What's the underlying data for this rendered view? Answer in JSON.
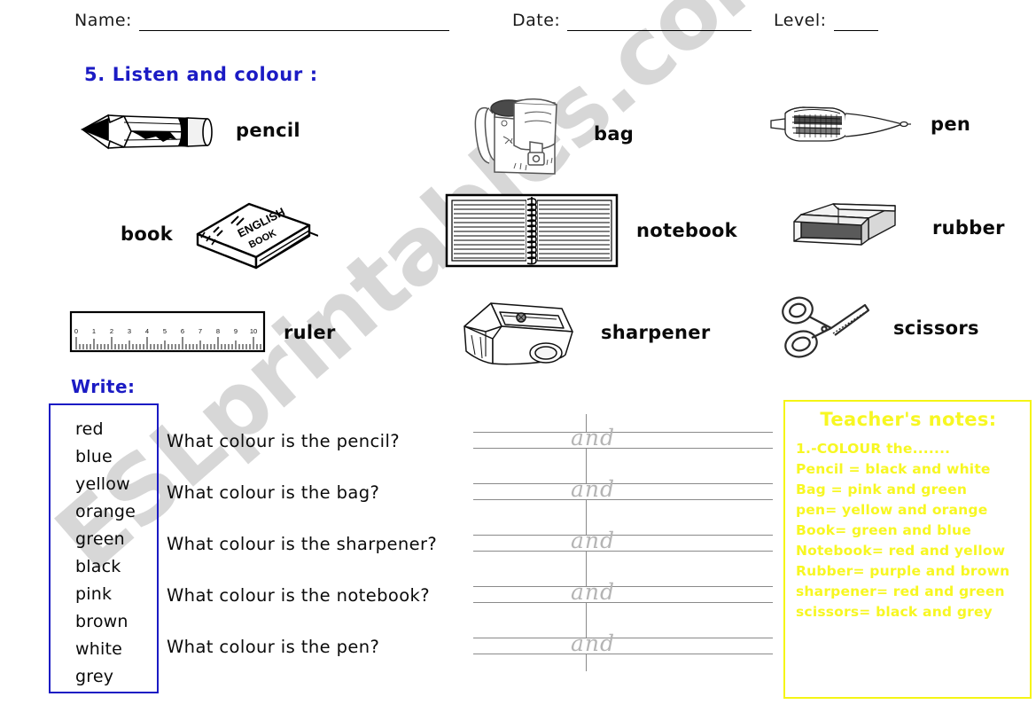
{
  "header": {
    "name_label": "Name:",
    "date_label": "Date:",
    "level_label": "Level:"
  },
  "section": {
    "title": "5. Listen and colour :"
  },
  "vocabulary": [
    {
      "key": "pencil",
      "label": "pencil",
      "icon": "pencil-icon"
    },
    {
      "key": "bag",
      "label": "bag",
      "icon": "bag-icon"
    },
    {
      "key": "pen",
      "label": "pen",
      "icon": "pen-icon"
    },
    {
      "key": "book",
      "label": "book",
      "icon": "book-icon",
      "book_text_line1": "ENGLISH",
      "book_text_line2": "BOOK"
    },
    {
      "key": "notebook",
      "label": "notebook",
      "icon": "notebook-icon"
    },
    {
      "key": "rubber",
      "label": "rubber",
      "icon": "rubber-icon"
    },
    {
      "key": "ruler",
      "label": "ruler",
      "icon": "ruler-icon",
      "ticks": [
        "0",
        "1",
        "2",
        "3",
        "4",
        "5",
        "6",
        "7",
        "8",
        "9",
        "10"
      ]
    },
    {
      "key": "sharpener",
      "label": "sharpener",
      "icon": "sharpener-icon"
    },
    {
      "key": "scissors",
      "label": "scissors",
      "icon": "scissors-icon"
    }
  ],
  "write": {
    "heading": "Write:",
    "colour_words": [
      "red",
      "blue",
      "yellow",
      "orange",
      "green",
      "black",
      "pink",
      "brown",
      "white",
      "grey"
    ],
    "questions": [
      {
        "text": "What colour is the pencil?",
        "answer_hint": "and"
      },
      {
        "text": "What colour is the bag?",
        "answer_hint": "and"
      },
      {
        "text": "What colour is the sharpener?",
        "answer_hint": "and"
      },
      {
        "text": "What colour is the notebook?",
        "answer_hint": "and"
      },
      {
        "text": "What colour is the pen?",
        "answer_hint": "and"
      }
    ]
  },
  "teacher_notes": {
    "title": "Teacher's notes:",
    "lines": [
      "1.-COLOUR the.......",
      "Pencil = black and white",
      "Bag = pink and green",
      "pen= yellow and orange",
      "Book= green and blue",
      "Notebook= red and yellow",
      "Rubber= purple and brown",
      "sharpener= red and green",
      "scissors= black and grey"
    ]
  },
  "watermark": {
    "text": "ESLprintables.com"
  },
  "colors": {
    "heading_blue": "#1b1bc4",
    "notes_yellow": "#f7f722",
    "rule_grey": "#8a8a8a",
    "cursive_grey": "#b4b4b4",
    "squiggle_green": "#2f8f2f"
  }
}
